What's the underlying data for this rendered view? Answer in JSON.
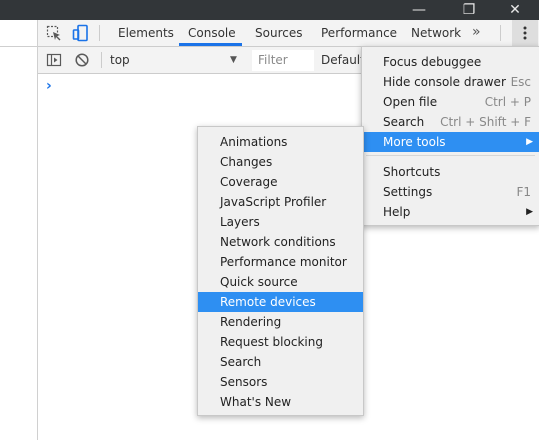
{
  "window": {
    "minimize_icon": "minimize-icon",
    "restore_icon": "restore-icon",
    "close_icon": "close-icon",
    "close_glyph": "✕",
    "restore_glyph": "❐",
    "minimize_glyph": "—"
  },
  "tabs": [
    {
      "label": "Elements"
    },
    {
      "label": "Console"
    },
    {
      "label": "Sources"
    },
    {
      "label": "Performance"
    },
    {
      "label": "Network"
    }
  ],
  "active_tab": "Console",
  "more_tabs_glyph": "»",
  "console_toolbar": {
    "context": "top",
    "filter_placeholder": "Filter",
    "levels": "Default"
  },
  "prompt_glyph": "›",
  "main_menu": {
    "items": [
      {
        "label": "Focus debuggee",
        "shortcut": ""
      },
      {
        "label": "Hide console drawer",
        "shortcut": "Esc"
      },
      {
        "label": "Open file",
        "shortcut": "Ctrl + P"
      },
      {
        "label": "Search",
        "shortcut": "Ctrl + Shift + F"
      },
      {
        "label": "More tools",
        "shortcut": "",
        "submenu": true,
        "highlighted": true
      },
      {
        "label": "Shortcuts",
        "shortcut": ""
      },
      {
        "label": "Settings",
        "shortcut": "F1"
      },
      {
        "label": "Help",
        "shortcut": "",
        "submenu": true
      }
    ]
  },
  "more_tools_menu": {
    "items": [
      "Animations",
      "Changes",
      "Coverage",
      "JavaScript Profiler",
      "Layers",
      "Network conditions",
      "Performance monitor",
      "Quick source",
      "Remote devices",
      "Rendering",
      "Request blocking",
      "Search",
      "Sensors",
      "What's New"
    ],
    "highlighted": "Remote devices"
  },
  "colors": {
    "accent": "#1a73e8",
    "menu_highlight": "#2e8ff2",
    "titlebar": "#323639"
  }
}
